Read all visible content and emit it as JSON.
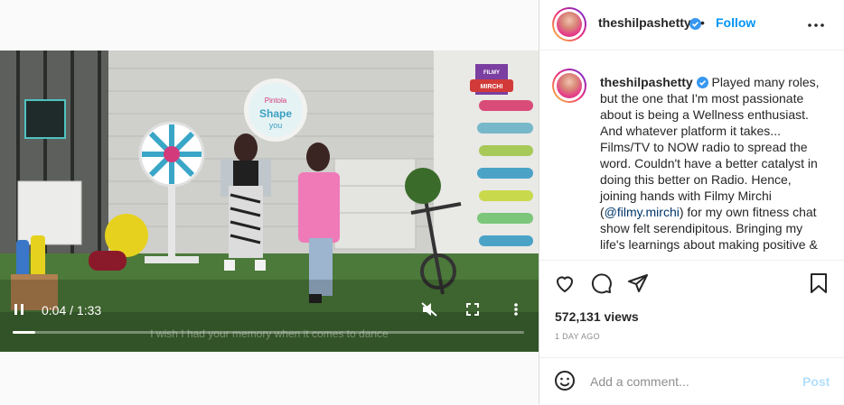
{
  "video": {
    "current_time": "0:04",
    "duration": "1:33",
    "progress_fraction": 0.045,
    "subtitle": "I wish I had your memory when it comes to dance",
    "brand_badge_text": "FILMY MIRCHI",
    "banner_text": "Pintola Shape you"
  },
  "header": {
    "username": "theshilpashetty",
    "separator": "•",
    "follow_label": "Follow"
  },
  "caption": {
    "username": "theshilpashetty",
    "text_before_mention": "Played many roles, but the one that I'm most passionate about is being a Wellness enthusiast. And whatever platform it takes... Films/TV to NOW radio to spread the word. Couldn't have a better catalyst in doing this better on Radio. Hence, joining hands with Filmy Mirchi (",
    "mention": "@filmy.mirchi",
    "text_after_mention": ") for my own fitness chat show felt serendipitous. Bringing my life's learnings about making positive &"
  },
  "stats": {
    "views": "572,131 views",
    "posted": "1 DAY AGO"
  },
  "comment_box": {
    "placeholder": "Add a comment...",
    "post_label": "Post"
  },
  "colors": {
    "accent": "#0095f6",
    "verified": "#3897f0",
    "post_disabled": "#b2dffc"
  }
}
